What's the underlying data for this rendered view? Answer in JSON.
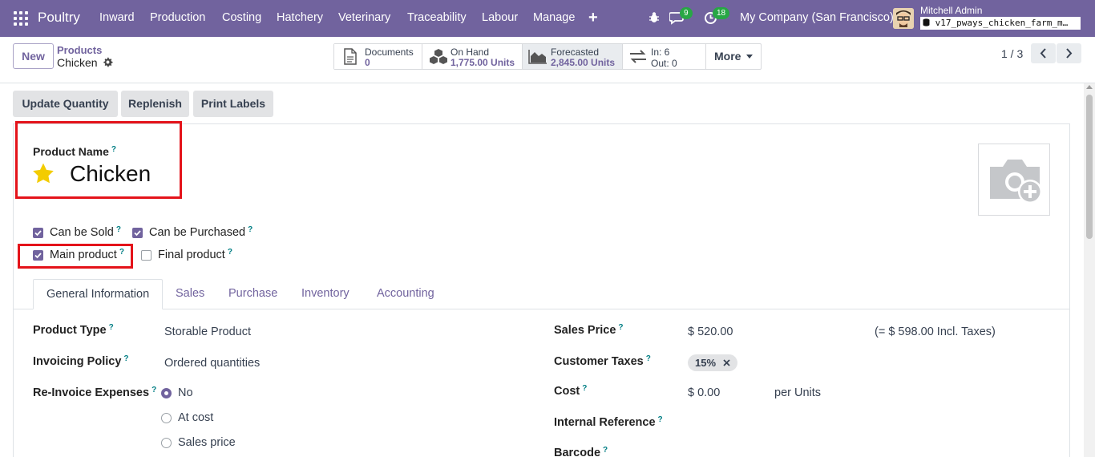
{
  "navbar": {
    "brand": "Poultry",
    "menu": [
      "Inward",
      "Production",
      "Costing",
      "Hatchery",
      "Veterinary",
      "Traceability",
      "Labour",
      "Manage"
    ],
    "messages_count": "9",
    "activities_count": "18",
    "company": "My Company (San Francisco)",
    "user_name": "Mitchell Admin",
    "database": "v17_pways_chicken_farm_m…"
  },
  "control_panel": {
    "new_label": "New",
    "breadcrumb_parent": "Products",
    "breadcrumb_current": "Chicken",
    "stats": {
      "documents_label": "Documents",
      "documents_value": "0",
      "on_hand_label": "On Hand",
      "on_hand_value": "1,775.00 Units",
      "forecasted_label": "Forecasted",
      "forecasted_value": "2,845.00 Units",
      "in_label": "In: 6",
      "out_label": "Out: 0",
      "more_label": "More"
    },
    "pager": "1 / 3"
  },
  "actions": {
    "update_quantity": "Update Quantity",
    "replenish": "Replenish",
    "print_labels": "Print Labels"
  },
  "form": {
    "product_name_label": "Product Name",
    "help_mark": "?",
    "product_name": "Chicken",
    "can_be_sold": {
      "label": "Can be Sold",
      "checked": true
    },
    "can_be_purchased": {
      "label": "Can be Purchased",
      "checked": true
    },
    "main_product": {
      "label": "Main product",
      "checked": true
    },
    "final_product": {
      "label": "Final product",
      "checked": false
    },
    "tabs": [
      "General Information",
      "Sales",
      "Purchase",
      "Inventory",
      "Accounting"
    ],
    "active_tab": "General Information",
    "left": {
      "product_type_label": "Product Type",
      "product_type_value": "Storable Product",
      "invoicing_policy_label": "Invoicing Policy",
      "invoicing_policy_value": "Ordered quantities",
      "reinvoice_label": "Re-Invoice Expenses",
      "reinvoice_options": [
        "No",
        "At cost",
        "Sales price"
      ],
      "reinvoice_selected": "No"
    },
    "right": {
      "sales_price_label": "Sales Price",
      "sales_price_value": "$ 520.00",
      "sales_price_incl": "(= $ 598.00 Incl. Taxes)",
      "customer_taxes_label": "Customer Taxes",
      "customer_taxes_tag": "15%",
      "cost_label": "Cost",
      "cost_value": "$ 0.00",
      "cost_unit": "per Units",
      "internal_reference_label": "Internal Reference",
      "barcode_label": "Barcode"
    }
  },
  "colors": {
    "brand": "#71639e",
    "highlight_box": "#e4131a",
    "star": "#f3cc00",
    "badge": "#28a745"
  }
}
